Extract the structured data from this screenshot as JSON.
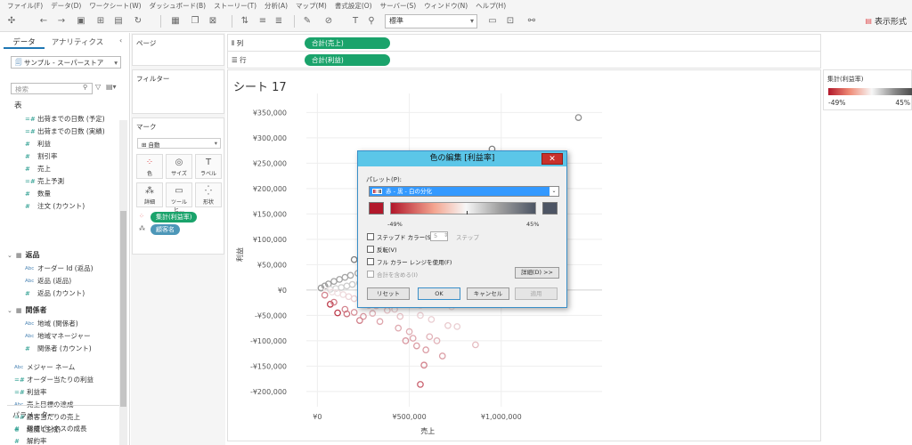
{
  "menu": [
    "ファイル(F)",
    "データ(D)",
    "ワークシート(W)",
    "ダッシュボード(B)",
    "ストーリー(T)",
    "分析(A)",
    "マップ(M)",
    "書式設定(O)",
    "サーバー(S)",
    "ウィンドウ(N)",
    "ヘルプ(H)"
  ],
  "toolbar": {
    "fit_value": "標準",
    "show_me": "表示形式"
  },
  "data_pane": {
    "tab_data": "データ",
    "tab_analytics": "アナリティクス",
    "datasource": "サンプル - スーパーストア",
    "search_placeholder": "検索",
    "tables_label": "表",
    "fields_top": [
      "出荷までの日数 (予定)",
      "出荷までの日数 (実績)",
      "利益",
      "割引率",
      "売上",
      "売上予測",
      "数量",
      "注文 (カウント)"
    ],
    "group_returns": "返品",
    "fields_returns": [
      "オーダー Id (返品)",
      "返品 (返品)",
      "返品 (カウント)"
    ],
    "group_people": "関係者",
    "fields_people": [
      "地域 (関係者)",
      "地域マネージャー",
      "関係者 (カウント)"
    ],
    "fields_bottom": [
      "メジャー ネーム",
      "オーダー当たりの利益",
      "利益率",
      "売上目標の達成",
      "顧客当たりの売上",
      "経度 (生成)"
    ],
    "param_label": "パラメーター",
    "params": [
      "新規ビジネスの成長",
      "解約率"
    ]
  },
  "cards": {
    "pages": "ページ",
    "filters": "フィルター",
    "marks": "マーク",
    "mark_type": "自動",
    "btn_color": "色",
    "btn_size": "サイズ",
    "btn_label": "ラベル",
    "btn_detail": "詳細",
    "btn_tooltip": "ツールヒ...",
    "btn_shape": "形状",
    "pill_color": "集計(利益率)",
    "pill_detail": "顧客名"
  },
  "shelves": {
    "columns_label": "列",
    "columns_pill": "合計(売上)",
    "rows_label": "行",
    "rows_pill": "合計(利益)"
  },
  "sheet_title": "シート 17",
  "legend": {
    "title": "集計(利益率)",
    "min": "-49%",
    "max": "45%"
  },
  "dialog": {
    "title": "色の編集 [利益率]",
    "palette_label": "パレット(P):",
    "palette_value": "赤 - 黒 - 白の分化",
    "min": "-49%",
    "max": "45%",
    "stepped": "ステップド カラー(S)",
    "steps_value": "5",
    "steps_unit": "ステップ",
    "reversed": "反転(V)",
    "full_range": "フル カラー レンジを使用(F)",
    "include_totals": "合計を含める(I)",
    "advanced": "詳細(D) >>",
    "reset": "リセット",
    "ok": "OK",
    "cancel": "キャンセル",
    "apply": "適用"
  },
  "colors": {
    "accent_green": "#1aa36b",
    "neg": "#b2182b",
    "mid": "#f7f7f7",
    "pos": "#4d4d4d",
    "dialog_title": "#5bc6e8"
  },
  "chart_data": {
    "type": "scatter",
    "xlabel": "売上",
    "ylabel": "利益",
    "x_ticks": [
      "¥0",
      "¥500,000",
      "¥1,000,000"
    ],
    "x_tick_values": [
      0,
      500000,
      1000000
    ],
    "y_ticks": [
      "¥350,000",
      "¥300,000",
      "¥250,000",
      "¥200,000",
      "¥150,000",
      "¥100,000",
      "¥50,000",
      "¥0",
      "-¥50,000",
      "-¥100,000",
      "-¥150,000",
      "-¥200,000"
    ],
    "y_tick_values": [
      350000,
      300000,
      250000,
      200000,
      150000,
      100000,
      50000,
      0,
      -50000,
      -100000,
      -150000,
      -200000
    ],
    "xlim": [
      -60000,
      1500000
    ],
    "ylim": [
      -230000,
      370000
    ],
    "color_field": "集計(利益率)",
    "color_range": [
      -0.49,
      0.45
    ],
    "points": [
      [
        1420000,
        340000,
        0.24
      ],
      [
        950000,
        278000,
        0.29
      ],
      [
        520000,
        128000,
        0.25
      ],
      [
        245000,
        79000,
        0.32
      ],
      [
        320000,
        73000,
        0.23
      ],
      [
        200000,
        60000,
        0.3
      ],
      [
        285000,
        62000,
        0.22
      ],
      [
        360000,
        55000,
        0.15
      ],
      [
        400000,
        50000,
        0.13
      ],
      [
        430000,
        44000,
        0.1
      ],
      [
        460000,
        38000,
        0.08
      ],
      [
        500000,
        30000,
        0.06
      ],
      [
        540000,
        25000,
        0.05
      ],
      [
        580000,
        23000,
        0.04
      ],
      [
        620000,
        21000,
        0.04
      ],
      [
        650000,
        19000,
        0.03
      ],
      [
        680000,
        15000,
        0.02
      ],
      [
        720000,
        12000,
        0.02
      ],
      [
        760000,
        10000,
        0.01
      ],
      [
        800000,
        8000,
        0.01
      ],
      [
        830000,
        6000,
        0.01
      ],
      [
        870000,
        5000,
        0.005
      ],
      [
        920000,
        4000,
        0.004
      ],
      [
        260000,
        41000,
        0.16
      ],
      [
        300000,
        39000,
        0.13
      ],
      [
        340000,
        34000,
        0.1
      ],
      [
        380000,
        28000,
        0.07
      ],
      [
        220000,
        33000,
        0.15
      ],
      [
        180000,
        29000,
        0.16
      ],
      [
        150000,
        25000,
        0.17
      ],
      [
        120000,
        21000,
        0.18
      ],
      [
        90000,
        17000,
        0.19
      ],
      [
        60000,
        12000,
        0.2
      ],
      [
        40000,
        8000,
        0.2
      ],
      [
        20000,
        4000,
        0.2
      ],
      [
        270000,
        20000,
        0.07
      ],
      [
        310000,
        15000,
        0.05
      ],
      [
        350000,
        10000,
        0.03
      ],
      [
        390000,
        6000,
        0.015
      ],
      [
        230000,
        14000,
        0.06
      ],
      [
        190000,
        11000,
        0.06
      ],
      [
        160000,
        8000,
        0.05
      ],
      [
        130000,
        5000,
        0.04
      ],
      [
        100000,
        3000,
        0.03
      ],
      [
        70000,
        1500,
        0.02
      ],
      [
        50000,
        -1000,
        -0.02
      ],
      [
        80000,
        -4000,
        -0.05
      ],
      [
        110000,
        -6000,
        -0.05
      ],
      [
        140000,
        -9000,
        -0.06
      ],
      [
        170000,
        -13000,
        -0.08
      ],
      [
        200000,
        -17000,
        -0.09
      ],
      [
        240000,
        -22000,
        -0.09
      ],
      [
        280000,
        -28000,
        -0.1
      ],
      [
        320000,
        -31000,
        -0.1
      ],
      [
        360000,
        -26000,
        -0.07
      ],
      [
        400000,
        -22000,
        -0.05
      ],
      [
        440000,
        -19000,
        -0.04
      ],
      [
        480000,
        -16000,
        -0.03
      ],
      [
        520000,
        -14000,
        -0.03
      ],
      [
        560000,
        -30000,
        -0.05
      ],
      [
        600000,
        -27000,
        -0.045
      ],
      [
        640000,
        -24000,
        -0.04
      ],
      [
        690000,
        -28000,
        -0.04
      ],
      [
        730000,
        -33000,
        -0.045
      ],
      [
        760000,
        -22000,
        -0.03
      ],
      [
        710000,
        -70000,
        -0.1
      ],
      [
        560000,
        -50000,
        -0.09
      ],
      [
        620000,
        -58000,
        -0.09
      ],
      [
        450000,
        -52000,
        -0.12
      ],
      [
        380000,
        -40000,
        -0.11
      ],
      [
        420000,
        -38000,
        -0.09
      ],
      [
        300000,
        -46000,
        -0.15
      ],
      [
        250000,
        -52000,
        -0.21
      ],
      [
        200000,
        -44000,
        -0.22
      ],
      [
        230000,
        -60000,
        -0.26
      ],
      [
        150000,
        -38000,
        -0.25
      ],
      [
        110000,
        -45000,
        -0.41
      ],
      [
        70000,
        -28000,
        -0.4
      ],
      [
        90000,
        -24000,
        -0.27
      ],
      [
        40000,
        -10000,
        -0.25
      ],
      [
        160000,
        -47000,
        -0.29
      ],
      [
        520000,
        -95000,
        -0.18
      ],
      [
        610000,
        -92000,
        -0.15
      ],
      [
        540000,
        -110000,
        -0.2
      ],
      [
        590000,
        -118000,
        -0.2
      ],
      [
        680000,
        -130000,
        -0.19
      ],
      [
        580000,
        -148000,
        -0.26
      ],
      [
        560000,
        -186000,
        -0.33
      ],
      [
        480000,
        -100000,
        -0.21
      ],
      [
        440000,
        -75000,
        -0.17
      ],
      [
        500000,
        -82000,
        -0.16
      ],
      [
        650000,
        -100000,
        -0.15
      ],
      [
        860000,
        -108000,
        -0.13
      ],
      [
        760000,
        -72000,
        -0.09
      ],
      [
        340000,
        -62000,
        -0.18
      ],
      [
        280000,
        -30000,
        -0.11
      ]
    ]
  }
}
